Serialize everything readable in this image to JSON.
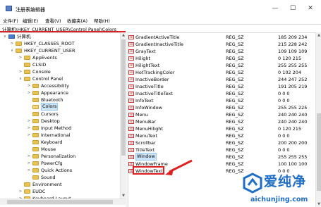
{
  "window": {
    "title": "注册表编辑器",
    "min_icon": "minimize-icon",
    "max_icon": "maximize-icon",
    "close_icon": "close-icon"
  },
  "menu": [
    "文件(F)",
    "编辑(E)",
    "查看(V)",
    "收藏夹(A)",
    "帮助(H)"
  ],
  "address": "计算机\\HKEY_CURRENT_USER\\Control Panel\\Colors",
  "tree": [
    {
      "label": "计算机",
      "expander": "∨",
      "kind": "pc"
    },
    {
      "label": "HKEY_CLASSES_ROOT",
      "expander": ">"
    },
    {
      "label": "HKEY_CURRENT_USER",
      "expander": "∨"
    },
    {
      "label": "AppEvents",
      "expander": ">"
    },
    {
      "label": "CLSID",
      "expander": ""
    },
    {
      "label": "Console",
      "expander": ">"
    },
    {
      "label": "Control Panel",
      "expander": "∨"
    },
    {
      "label": "Accessibility",
      "expander": ">"
    },
    {
      "label": "Appearance",
      "expander": ">"
    },
    {
      "label": "Bluetooth",
      "expander": ""
    },
    {
      "label": "Colors",
      "expander": "",
      "selected": true
    },
    {
      "label": "Cursors",
      "expander": ""
    },
    {
      "label": "Desktop",
      "expander": ">"
    },
    {
      "label": "Input Method",
      "expander": ">"
    },
    {
      "label": "International",
      "expander": ">"
    },
    {
      "label": "Keyboard",
      "expander": ""
    },
    {
      "label": "Mouse",
      "expander": ""
    },
    {
      "label": "Personalization",
      "expander": ">"
    },
    {
      "label": "PowerCfg",
      "expander": ">"
    },
    {
      "label": "Quick Actions",
      "expander": ">"
    },
    {
      "label": "Sound",
      "expander": ""
    },
    {
      "label": "Environment",
      "expander": ""
    },
    {
      "label": "EUDC",
      "expander": ">"
    },
    {
      "label": "Keyboard Layout",
      "expander": ">"
    }
  ],
  "values": [
    {
      "name": "GradientActiveTitle",
      "type": "REG_SZ",
      "data": "185 209 234"
    },
    {
      "name": "GradientInactiveTitle",
      "type": "REG_SZ",
      "data": "215 228 242"
    },
    {
      "name": "GrayText",
      "type": "REG_SZ",
      "data": "109 109 109"
    },
    {
      "name": "Hilight",
      "type": "REG_SZ",
      "data": "0 120 215"
    },
    {
      "name": "HilightText",
      "type": "REG_SZ",
      "data": "255 255 255"
    },
    {
      "name": "HotTrackingColor",
      "type": "REG_SZ",
      "data": "0 102 204"
    },
    {
      "name": "InactiveBorder",
      "type": "REG_SZ",
      "data": "244 247 252"
    },
    {
      "name": "InactiveTitle",
      "type": "REG_SZ",
      "data": "191 205 219"
    },
    {
      "name": "InactiveTitleText",
      "type": "REG_SZ",
      "data": "0 0 0"
    },
    {
      "name": "InfoText",
      "type": "REG_SZ",
      "data": "0 0 0"
    },
    {
      "name": "InfoWindow",
      "type": "REG_SZ",
      "data": "255 255 225"
    },
    {
      "name": "Menu",
      "type": "REG_SZ",
      "data": "240 240 240"
    },
    {
      "name": "MenuBar",
      "type": "REG_SZ",
      "data": "240 240 240"
    },
    {
      "name": "MenuHilight",
      "type": "REG_SZ",
      "data": "0 120 215"
    },
    {
      "name": "MenuText",
      "type": "REG_SZ",
      "data": "0 0 0"
    },
    {
      "name": "Scrollbar",
      "type": "REG_SZ",
      "data": "200 200 200"
    },
    {
      "name": "TitleText",
      "type": "REG_SZ",
      "data": "0 0 0"
    },
    {
      "name": "Window",
      "type": "REG_SZ",
      "data": "255 255 255",
      "selected": true
    },
    {
      "name": "WindowFrame",
      "type": "REG_SZ",
      "data": "100 100 100"
    },
    {
      "name": "WindowText",
      "type": "REG_SZ",
      "data": "0 0 0"
    }
  ],
  "watermark": {
    "title": "爱纯净",
    "url": "aichunjing.com"
  },
  "colors": {
    "highlight_red": "#e02020",
    "watermark_blue": "#1f6ec7",
    "selection": "#cce4f7"
  }
}
